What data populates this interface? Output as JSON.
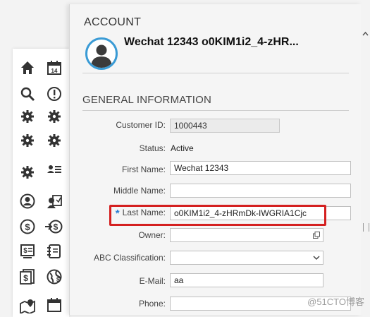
{
  "sidebar": {
    "icons": [
      {
        "name": "home-icon"
      },
      {
        "name": "calendar-14-icon"
      },
      {
        "name": "search-icon"
      },
      {
        "name": "alert-icon"
      },
      {
        "name": "gear-icon"
      },
      {
        "name": "gear-icon"
      },
      {
        "name": "gear-icon"
      },
      {
        "name": "gear-icon"
      },
      {
        "name": "gear-icon"
      },
      {
        "name": "user-list-icon"
      },
      {
        "name": "user-circle-icon"
      },
      {
        "name": "user-card-icon"
      },
      {
        "name": "dollar-circle-icon"
      },
      {
        "name": "arrow-dollar-icon"
      },
      {
        "name": "dollar-doc-icon"
      },
      {
        "name": "notebook-icon"
      },
      {
        "name": "dollar-document-icon"
      },
      {
        "name": "globe-dollar-icon"
      },
      {
        "name": "map-pin-icon"
      },
      {
        "name": "calendar-icon"
      }
    ]
  },
  "account": {
    "section_title": "ACCOUNT",
    "name": "Wechat 12343 o0KIM1i2_4-zHR..."
  },
  "general": {
    "section_title": "GENERAL INFORMATION",
    "customer_id_label": "Customer ID:",
    "customer_id_value": "1000443",
    "status_label": "Status:",
    "status_value": "Active",
    "first_name_label": "First Name:",
    "first_name_value": "Wechat 12343",
    "middle_name_label": "Middle Name:",
    "middle_name_value": "",
    "last_name_label": "Last Name:",
    "last_name_value": "o0KIM1i2_4-zHRmDk-IWGRIA1Cjc",
    "owner_label": "Owner:",
    "owner_value": "",
    "abc_label": "ABC Classification:",
    "abc_value": "",
    "email_label": "E-Mail:",
    "email_value": "aa",
    "phone_label": "Phone:",
    "phone_value": ""
  },
  "watermark": "@51CTO博客",
  "colors": {
    "accent": "#3a9bd5",
    "highlight": "#d42020",
    "required": "#2a7fd4"
  }
}
